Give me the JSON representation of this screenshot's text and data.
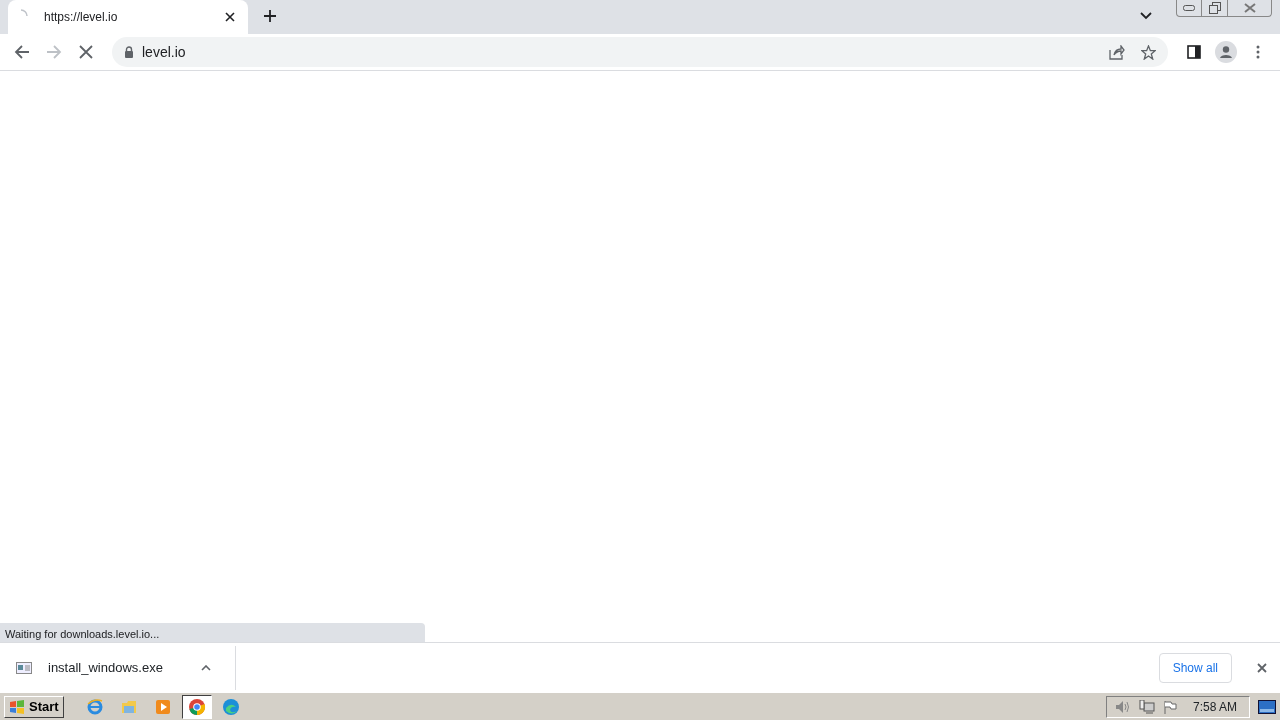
{
  "tab": {
    "title": "https://level.io"
  },
  "address": {
    "text": "level.io"
  },
  "status_bubble": "Waiting for downloads.level.io...",
  "download_shelf": {
    "file": "install_windows.exe",
    "show_all": "Show all"
  },
  "taskbar": {
    "start": "Start",
    "apps": [
      {
        "kind": "ie",
        "selected": false
      },
      {
        "kind": "explorer",
        "selected": false
      },
      {
        "kind": "media",
        "selected": false
      },
      {
        "kind": "chrome",
        "selected": true
      },
      {
        "kind": "edge",
        "selected": false
      }
    ],
    "clock": "7:58 AM"
  }
}
